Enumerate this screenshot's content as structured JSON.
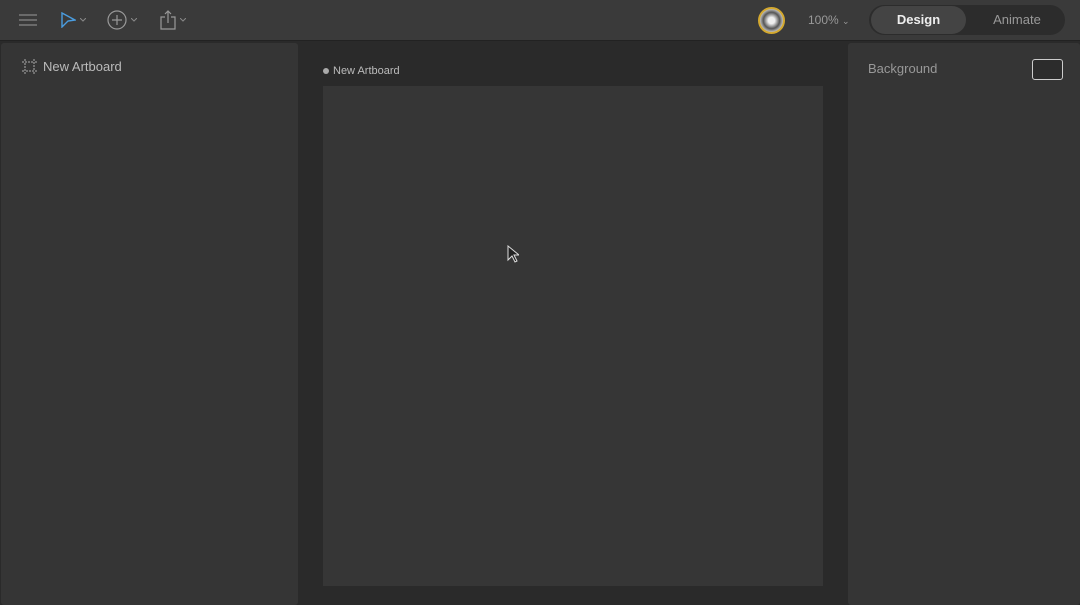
{
  "toolbar": {
    "zoom": "100%",
    "mode_tabs": [
      {
        "label": "Design",
        "active": true
      },
      {
        "label": "Animate",
        "active": false
      }
    ],
    "icons": [
      "menu-icon",
      "select-icon",
      "add-icon",
      "share-icon"
    ]
  },
  "layers": {
    "items": [
      {
        "label": "New Artboard",
        "icon": "artboard-icon"
      }
    ]
  },
  "canvas": {
    "artboard_label": "New Artboard"
  },
  "inspector": {
    "background_label": "Background",
    "background_color": "#2c2c2c"
  },
  "colors": {
    "accent": "#4a9de0",
    "avatar_ring": "#d4a92f"
  }
}
